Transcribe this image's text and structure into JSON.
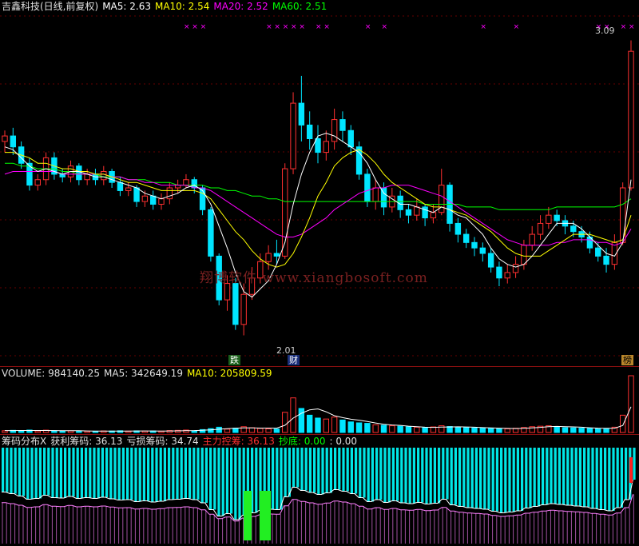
{
  "price_header": {
    "name": "吉鑫科技(日线,前复权)",
    "ma5": "MA5: 2.63",
    "ma10": "MA10: 2.54",
    "ma20": "MA20: 2.52",
    "ma60": "MA60: 2.51"
  },
  "volume_header": {
    "label": "VOLUME: 984140.25",
    "ma5": "MA5: 342649.19",
    "ma10": "MA10: 205809.59"
  },
  "chip_header": {
    "title": "筹码分布X",
    "profit": "获利筹码: 36.13",
    "loss": "亏损筹码: 34.74",
    "main": "主力控筹: 36.13",
    "bottom": "抄底: 0.00",
    "extra": ": 0.00"
  },
  "annotations": {
    "high": "3.09",
    "low": "2.01",
    "marker_die": "跌",
    "marker_cai": "财",
    "marker_bang": "榜",
    "watermark": "翔博软件 www.xiangbosoft.com"
  },
  "colors": {
    "up": "#ff3030",
    "down": "#00e5ff",
    "ma5": "#ffffff",
    "ma10": "#ffff00",
    "ma20": "#ff00ff",
    "ma60": "#00ff00",
    "profit_bars": "#00e5e5",
    "chip_light": "#ff80ff"
  },
  "chart_data": {
    "type": "candlestick",
    "title": "吉鑫科技(日线,前复权)",
    "price_ylim": [
      1.95,
      3.15
    ],
    "annotated_high": 3.09,
    "annotated_low": 2.01,
    "candles": [
      [
        2.72,
        2.74,
        2.76,
        2.68
      ],
      [
        2.74,
        2.7,
        2.77,
        2.67
      ],
      [
        2.7,
        2.64,
        2.72,
        2.62
      ],
      [
        2.64,
        2.56,
        2.66,
        2.54
      ],
      [
        2.56,
        2.58,
        2.6,
        2.54
      ],
      [
        2.58,
        2.66,
        2.68,
        2.56
      ],
      [
        2.66,
        2.6,
        2.68,
        2.58
      ],
      [
        2.6,
        2.59,
        2.62,
        2.57
      ],
      [
        2.59,
        2.63,
        2.65,
        2.57
      ],
      [
        2.63,
        2.58,
        2.64,
        2.56
      ],
      [
        2.58,
        2.6,
        2.62,
        2.56
      ],
      [
        2.6,
        2.58,
        2.62,
        2.56
      ],
      [
        2.58,
        2.61,
        2.63,
        2.56
      ],
      [
        2.61,
        2.57,
        2.62,
        2.55
      ],
      [
        2.57,
        2.54,
        2.59,
        2.52
      ],
      [
        2.54,
        2.55,
        2.57,
        2.52
      ],
      [
        2.55,
        2.5,
        2.56,
        2.48
      ],
      [
        2.5,
        2.52,
        2.54,
        2.48
      ],
      [
        2.52,
        2.49,
        2.54,
        2.47
      ],
      [
        2.49,
        2.51,
        2.53,
        2.47
      ],
      [
        2.51,
        2.55,
        2.57,
        2.49
      ],
      [
        2.55,
        2.56,
        2.58,
        2.53
      ],
      [
        2.56,
        2.58,
        2.6,
        2.55
      ],
      [
        2.58,
        2.55,
        2.59,
        2.53
      ],
      [
        2.55,
        2.47,
        2.56,
        2.45
      ],
      [
        2.47,
        2.3,
        2.48,
        2.28
      ],
      [
        2.3,
        2.14,
        2.31,
        2.12
      ],
      [
        2.14,
        2.2,
        2.23,
        2.1
      ],
      [
        2.2,
        2.05,
        2.22,
        2.03
      ],
      [
        2.05,
        2.16,
        2.2,
        2.01
      ],
      [
        2.16,
        2.22,
        2.26,
        2.14
      ],
      [
        2.22,
        2.28,
        2.31,
        2.2
      ],
      [
        2.28,
        2.31,
        2.34,
        2.25
      ],
      [
        2.31,
        2.3,
        2.36,
        2.27
      ],
      [
        2.3,
        2.62,
        2.64,
        2.29
      ],
      [
        2.62,
        2.86,
        2.9,
        2.6
      ],
      [
        2.86,
        2.78,
        2.96,
        2.72
      ],
      [
        2.78,
        2.73,
        2.83,
        2.69
      ],
      [
        2.73,
        2.68,
        2.78,
        2.64
      ],
      [
        2.68,
        2.72,
        2.76,
        2.65
      ],
      [
        2.72,
        2.8,
        2.84,
        2.69
      ],
      [
        2.8,
        2.76,
        2.83,
        2.72
      ],
      [
        2.76,
        2.7,
        2.78,
        2.67
      ],
      [
        2.7,
        2.6,
        2.72,
        2.58
      ],
      [
        2.6,
        2.5,
        2.62,
        2.48
      ],
      [
        2.5,
        2.55,
        2.58,
        2.47
      ],
      [
        2.55,
        2.48,
        2.57,
        2.45
      ],
      [
        2.48,
        2.52,
        2.55,
        2.46
      ],
      [
        2.52,
        2.47,
        2.54,
        2.44
      ],
      [
        2.47,
        2.45,
        2.49,
        2.42
      ],
      [
        2.45,
        2.48,
        2.51,
        2.43
      ],
      [
        2.48,
        2.44,
        2.49,
        2.41
      ],
      [
        2.44,
        2.46,
        2.49,
        2.42
      ],
      [
        2.46,
        2.56,
        2.62,
        2.45
      ],
      [
        2.56,
        2.42,
        2.57,
        2.39
      ],
      [
        2.42,
        2.38,
        2.44,
        2.35
      ],
      [
        2.38,
        2.35,
        2.4,
        2.33
      ],
      [
        2.35,
        2.33,
        2.37,
        2.3
      ],
      [
        2.33,
        2.31,
        2.35,
        2.28
      ],
      [
        2.31,
        2.26,
        2.33,
        2.24
      ],
      [
        2.26,
        2.22,
        2.28,
        2.19
      ],
      [
        2.22,
        2.24,
        2.27,
        2.2
      ],
      [
        2.24,
        2.27,
        2.3,
        2.22
      ],
      [
        2.27,
        2.34,
        2.36,
        2.25
      ],
      [
        2.34,
        2.38,
        2.41,
        2.32
      ],
      [
        2.38,
        2.42,
        2.45,
        2.36
      ],
      [
        2.42,
        2.45,
        2.48,
        2.4
      ],
      [
        2.45,
        2.43,
        2.47,
        2.41
      ],
      [
        2.43,
        2.41,
        2.45,
        2.38
      ],
      [
        2.41,
        2.39,
        2.43,
        2.37
      ],
      [
        2.39,
        2.37,
        2.41,
        2.35
      ],
      [
        2.37,
        2.33,
        2.39,
        2.31
      ],
      [
        2.33,
        2.3,
        2.35,
        2.28
      ],
      [
        2.3,
        2.27,
        2.33,
        2.24
      ],
      [
        2.27,
        2.35,
        2.38,
        2.25
      ],
      [
        2.35,
        2.55,
        2.57,
        2.34
      ],
      [
        2.55,
        3.05,
        3.09,
        2.54
      ]
    ],
    "ma5": [
      2.7,
      2.69,
      2.66,
      2.63,
      2.61,
      2.62,
      2.61,
      2.6,
      2.61,
      2.61,
      2.6,
      2.59,
      2.59,
      2.58,
      2.57,
      2.56,
      2.55,
      2.53,
      2.52,
      2.51,
      2.52,
      2.53,
      2.55,
      2.56,
      2.54,
      2.49,
      2.41,
      2.33,
      2.24,
      2.17,
      2.15,
      2.18,
      2.21,
      2.27,
      2.35,
      2.49,
      2.6,
      2.68,
      2.74,
      2.75,
      2.74,
      2.72,
      2.7,
      2.68,
      2.64,
      2.58,
      2.53,
      2.51,
      2.49,
      2.49,
      2.48,
      2.47,
      2.46,
      2.48,
      2.47,
      2.45,
      2.44,
      2.41,
      2.38,
      2.33,
      2.29,
      2.27,
      2.26,
      2.27,
      2.3,
      2.34,
      2.38,
      2.42,
      2.42,
      2.42,
      2.4,
      2.37,
      2.34,
      2.31,
      2.3,
      2.35,
      2.58
    ],
    "ma10": [
      2.68,
      2.68,
      2.67,
      2.66,
      2.64,
      2.64,
      2.63,
      2.62,
      2.62,
      2.61,
      2.61,
      2.6,
      2.6,
      2.59,
      2.58,
      2.57,
      2.57,
      2.56,
      2.55,
      2.54,
      2.54,
      2.54,
      2.54,
      2.54,
      2.53,
      2.51,
      2.47,
      2.43,
      2.39,
      2.36,
      2.32,
      2.29,
      2.27,
      2.26,
      2.27,
      2.31,
      2.37,
      2.44,
      2.52,
      2.57,
      2.63,
      2.66,
      2.68,
      2.69,
      2.67,
      2.64,
      2.6,
      2.57,
      2.55,
      2.53,
      2.51,
      2.49,
      2.48,
      2.48,
      2.47,
      2.46,
      2.45,
      2.43,
      2.41,
      2.39,
      2.36,
      2.33,
      2.31,
      2.3,
      2.3,
      2.3,
      2.32,
      2.34,
      2.36,
      2.38,
      2.38,
      2.38,
      2.37,
      2.36,
      2.35,
      2.36,
      2.45
    ],
    "ma20": [
      2.6,
      2.61,
      2.61,
      2.61,
      2.61,
      2.61,
      2.61,
      2.6,
      2.6,
      2.6,
      2.6,
      2.6,
      2.6,
      2.59,
      2.59,
      2.58,
      2.58,
      2.57,
      2.57,
      2.56,
      2.56,
      2.56,
      2.56,
      2.55,
      2.55,
      2.54,
      2.52,
      2.5,
      2.48,
      2.46,
      2.44,
      2.42,
      2.4,
      2.38,
      2.37,
      2.37,
      2.38,
      2.4,
      2.42,
      2.44,
      2.47,
      2.49,
      2.51,
      2.53,
      2.54,
      2.55,
      2.55,
      2.56,
      2.56,
      2.56,
      2.55,
      2.54,
      2.53,
      2.52,
      2.5,
      2.48,
      2.46,
      2.44,
      2.42,
      2.4,
      2.38,
      2.36,
      2.35,
      2.34,
      2.34,
      2.34,
      2.34,
      2.35,
      2.35,
      2.36,
      2.36,
      2.36,
      2.35,
      2.35,
      2.34,
      2.35,
      2.4
    ],
    "ma60": [
      2.64,
      2.64,
      2.63,
      2.63,
      2.62,
      2.62,
      2.62,
      2.61,
      2.61,
      2.6,
      2.6,
      2.6,
      2.59,
      2.59,
      2.59,
      2.58,
      2.58,
      2.58,
      2.57,
      2.57,
      2.57,
      2.56,
      2.56,
      2.56,
      2.56,
      2.55,
      2.55,
      2.54,
      2.54,
      2.53,
      2.52,
      2.52,
      2.51,
      2.51,
      2.5,
      2.5,
      2.5,
      2.5,
      2.5,
      2.5,
      2.5,
      2.5,
      2.5,
      2.5,
      2.5,
      2.5,
      2.5,
      2.5,
      2.5,
      2.5,
      2.5,
      2.49,
      2.49,
      2.49,
      2.49,
      2.49,
      2.48,
      2.48,
      2.48,
      2.48,
      2.47,
      2.47,
      2.47,
      2.47,
      2.47,
      2.47,
      2.47,
      2.48,
      2.48,
      2.48,
      2.48,
      2.48,
      2.48,
      2.48,
      2.48,
      2.49,
      2.51
    ],
    "volume": [
      18,
      22,
      20,
      25,
      16,
      24,
      18,
      14,
      17,
      15,
      14,
      13,
      16,
      15,
      18,
      14,
      17,
      15,
      16,
      14,
      20,
      22,
      25,
      18,
      30,
      40,
      55,
      35,
      45,
      60,
      50,
      42,
      38,
      36,
      210,
      360,
      250,
      180,
      150,
      140,
      160,
      130,
      110,
      100,
      95,
      80,
      75,
      70,
      65,
      60,
      55,
      50,
      58,
      70,
      62,
      55,
      50,
      48,
      45,
      42,
      40,
      38,
      44,
      52,
      60,
      65,
      70,
      58,
      50,
      48,
      45,
      42,
      40,
      38,
      55,
      180,
      984
    ],
    "volume_ma5": [
      20,
      20,
      21,
      21,
      21,
      21,
      20,
      19,
      18,
      18,
      16,
      15,
      15,
      15,
      15,
      15,
      16,
      16,
      16,
      15,
      16,
      17,
      19,
      20,
      23,
      27,
      34,
      40,
      45,
      47,
      48,
      46,
      46,
      45,
      75,
      150,
      200,
      235,
      245,
      215,
      175,
      155,
      138,
      128,
      115,
      99,
      86,
      78,
      74,
      66,
      60,
      55,
      53,
      56,
      57,
      59,
      57,
      55,
      51,
      48,
      45,
      42,
      41,
      43,
      47,
      53,
      60,
      63,
      61,
      58,
      55,
      49,
      45,
      43,
      44,
      73,
      268
    ]
  }
}
